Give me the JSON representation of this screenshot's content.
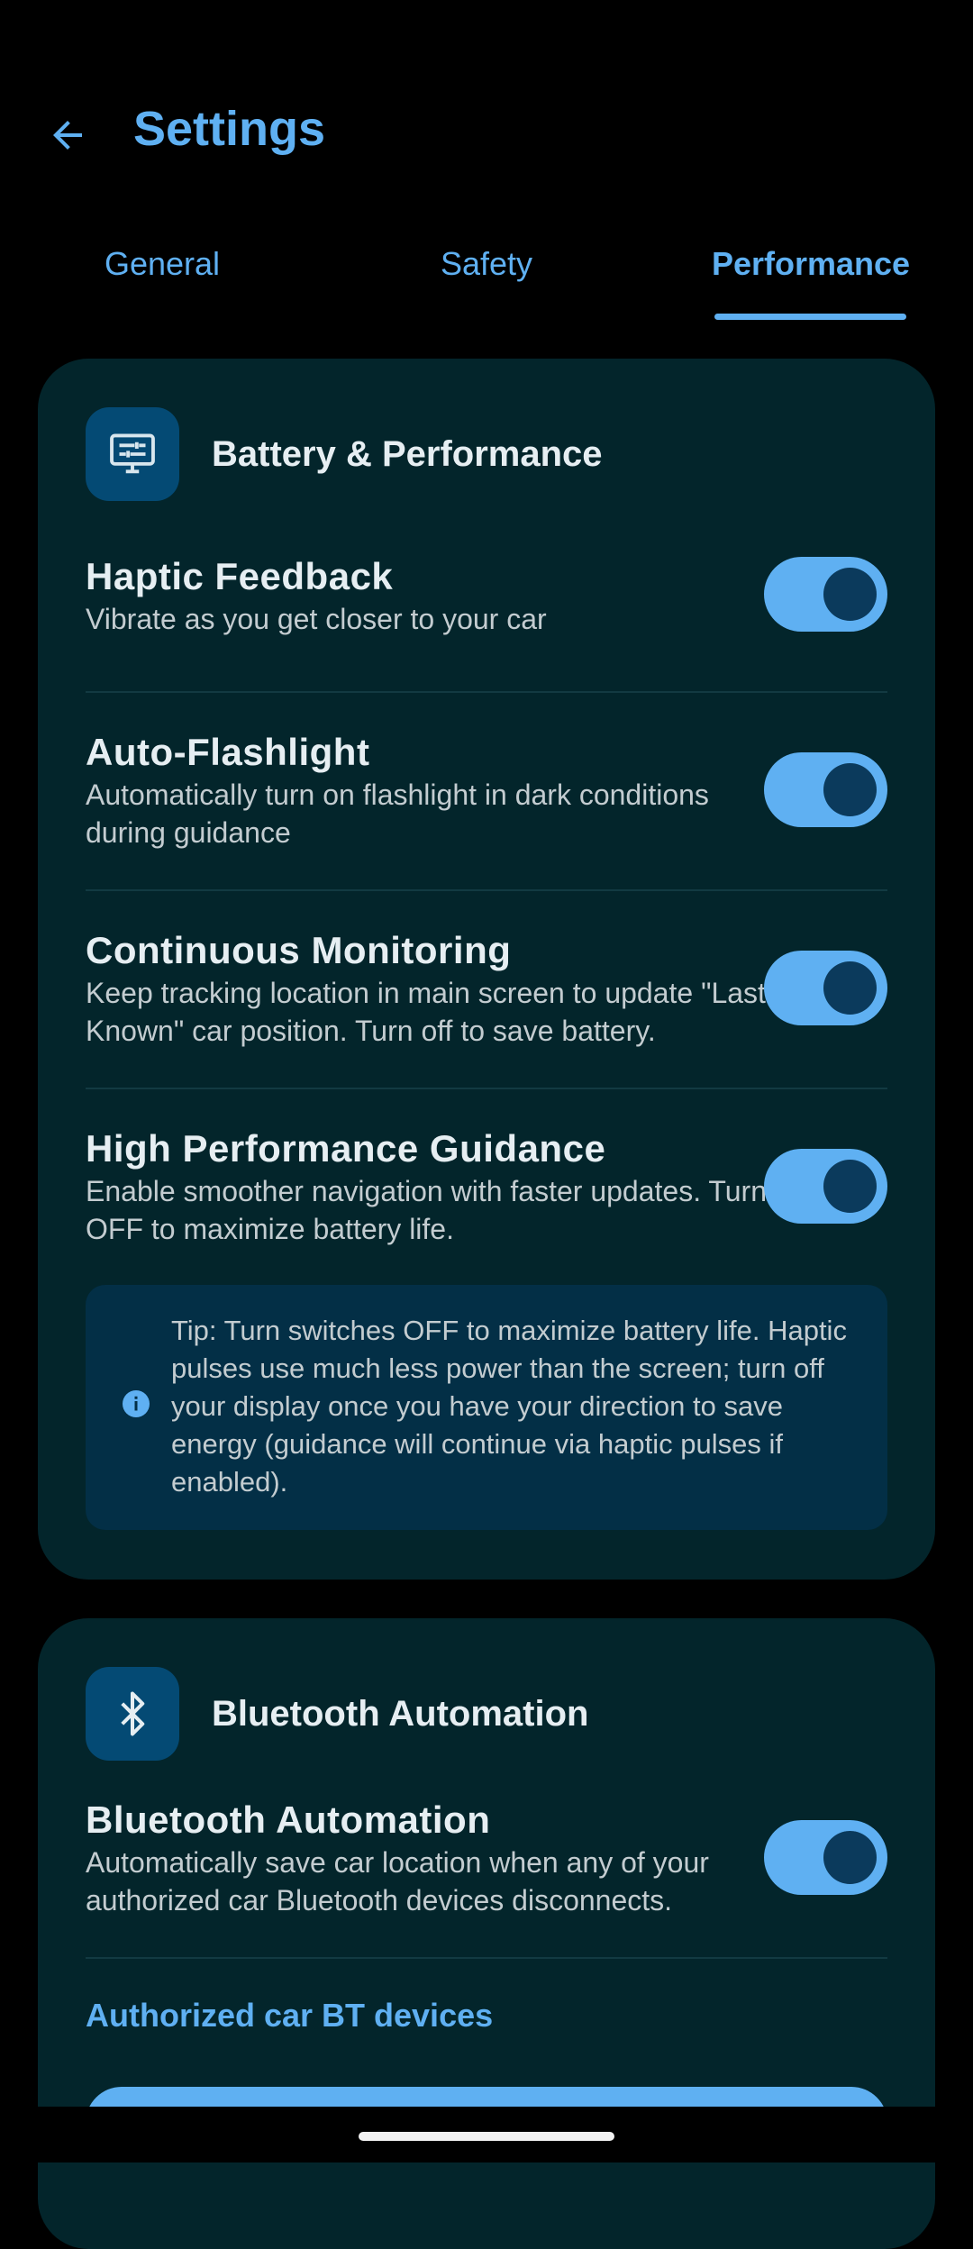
{
  "header": {
    "title": "Settings"
  },
  "tabs": [
    {
      "label": "General"
    },
    {
      "label": "Safety"
    },
    {
      "label": "Performance"
    }
  ],
  "active_tab": "Performance",
  "battery_card": {
    "title": "Battery & Performance",
    "icon": "tune-monitor-icon",
    "items": [
      {
        "title": "Haptic Feedback",
        "desc": "Vibrate as you get closer to your car",
        "enabled": true
      },
      {
        "title": "Auto-Flashlight",
        "desc": "Automatically turn on flashlight in dark conditions during guidance",
        "enabled": true
      },
      {
        "title": "Continuous Monitoring",
        "desc": "Keep tracking location in main screen to update \"Last Known\" car position. Turn off to save battery.",
        "enabled": true
      },
      {
        "title": "High Performance Guidance",
        "desc": "Enable smoother navigation with faster updates. Turn OFF to maximize battery life.",
        "enabled": true
      }
    ],
    "tip": "Tip: Turn switches OFF to maximize battery life. Haptic pulses use much less power than the screen; turn off your display once you have your direction to save energy (guidance will continue via haptic pulses if enabled)."
  },
  "bluetooth_card": {
    "title": "Bluetooth Automation",
    "icon": "bluetooth-icon",
    "items": [
      {
        "title": "Bluetooth Automation",
        "desc": "Automatically save car location when any of your authorized car Bluetooth devices disconnects.",
        "enabled": true
      }
    ],
    "section_label": "Authorized car BT devices"
  },
  "colors": {
    "accent": "#5fb0f2",
    "card_bg": "#03252b",
    "icon_bg": "#044a74",
    "tip_bg": "#032f46",
    "knob": "#0b3a5c"
  }
}
